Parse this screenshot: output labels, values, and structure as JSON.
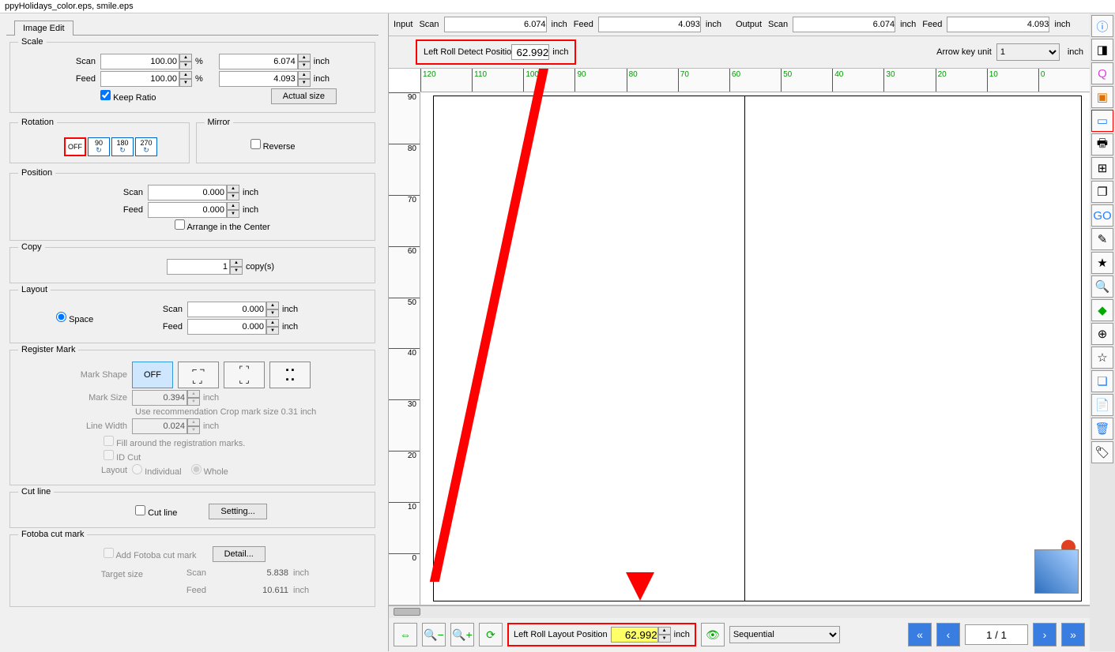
{
  "title": "ppyHolidays_color.eps, smile.eps",
  "tab": "Image Edit",
  "scale": {
    "title": "Scale",
    "scan_label": "Scan",
    "scan_pct": "100.00",
    "pct_unit": "%",
    "scan_val": "6.074",
    "inch": "inch",
    "feed_label": "Feed",
    "feed_pct": "100.00",
    "feed_val": "4.093",
    "keep_ratio": "Keep Ratio",
    "actual_size": "Actual size"
  },
  "rotation": {
    "title": "Rotation",
    "off": "OFF",
    "r90": "90",
    "r180": "180",
    "r270": "270"
  },
  "mirror": {
    "title": "Mirror",
    "reverse": "Reverse"
  },
  "position": {
    "title": "Position",
    "scan_label": "Scan",
    "scan_val": "0.000",
    "feed_label": "Feed",
    "feed_val": "0.000",
    "arrange": "Arrange in the Center",
    "inch": "inch"
  },
  "copy": {
    "title": "Copy",
    "val": "1",
    "unit": "copy(s)"
  },
  "layout": {
    "title": "Layout",
    "space": "Space",
    "scan_label": "Scan",
    "scan_val": "0.000",
    "feed_label": "Feed",
    "feed_val": "0.000",
    "inch": "inch"
  },
  "register": {
    "title": "Register Mark",
    "mark_shape": "Mark Shape",
    "off": "OFF",
    "mark_size": "Mark Size",
    "mark_size_val": "0.394",
    "inch": "inch",
    "rec": "Use recommendation Crop mark size  0.31 inch",
    "line_width": "Line Width",
    "line_width_val": "0.024",
    "fill": "Fill around the registration marks.",
    "idcut": "ID Cut",
    "layout": "Layout",
    "individual": "Individual",
    "whole": "Whole"
  },
  "cutline": {
    "title": "Cut line",
    "chk": "Cut line",
    "btn": "Setting..."
  },
  "fotoba": {
    "title": "Fotoba cut mark",
    "chk": "Add Fotoba cut mark",
    "btn": "Detail...",
    "target": "Target size",
    "scan_label": "Scan",
    "scan_val": "5.838",
    "feed_label": "Feed",
    "feed_val": "10.611",
    "inch": "inch"
  },
  "topbar": {
    "input": "Input",
    "output": "Output",
    "scan": "Scan",
    "feed": "Feed",
    "inch": "inch",
    "in_scan": "6.074",
    "in_feed": "4.093",
    "out_scan": "6.074",
    "out_feed": "4.093"
  },
  "secondbar": {
    "left_roll_detect": "Left Roll Detect Positio",
    "detect_val": "62.992",
    "inch": "inch",
    "arrow_key_unit": "Arrow key unit",
    "unit_val": "1"
  },
  "ruler_h": [
    "120",
    "110",
    "100",
    "90",
    "80",
    "70",
    "60",
    "50",
    "40",
    "30",
    "20",
    "10",
    "0"
  ],
  "ruler_v": [
    "0",
    "10",
    "20",
    "30",
    "40",
    "50",
    "60",
    "70",
    "80",
    "90"
  ],
  "bottom": {
    "left_roll_layout": "Left Roll Layout Position",
    "layout_val": "62.992",
    "inch": "inch",
    "mode": "Sequential",
    "pager": "1 / 1"
  }
}
